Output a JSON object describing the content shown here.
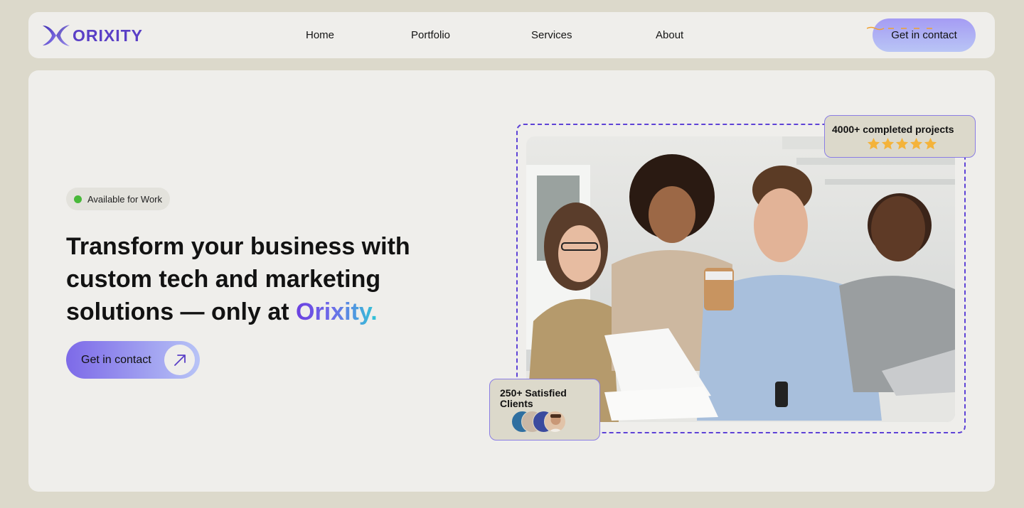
{
  "brand": {
    "name": "ORIXITY",
    "accent": "#5a3fc6"
  },
  "nav": {
    "links": [
      "Home",
      "Portfolio",
      "Services",
      "About"
    ],
    "cta_label": "Get in contact"
  },
  "hero": {
    "badge": "Available for Work",
    "headline_part1": "Transform your business with custom tech and marketing solutions — only at ",
    "headline_brand": "Orixity.",
    "cta_label": "Get in contact",
    "cta_icon": "arrow-up-right-icon"
  },
  "stats": {
    "projects_label": "4000+ completed projects",
    "projects_rating": 5,
    "clients_label": "250+ Satisfied Clients"
  },
  "colors": {
    "page_bg": "#dcd9cb",
    "card_bg": "#efeeeb",
    "status_green": "#49b93a",
    "star": "#f4b33a",
    "dashed": "#5e43d6"
  }
}
